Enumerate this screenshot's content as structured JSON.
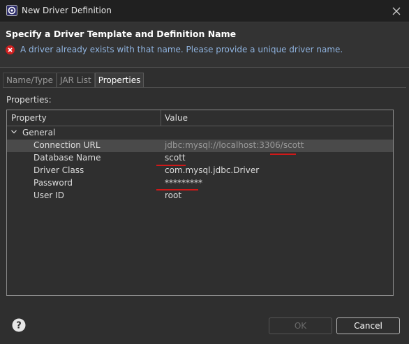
{
  "window": {
    "title": "New Driver Definition"
  },
  "header": {
    "title": "Specify a Driver Template and Definition Name",
    "error_message": "A driver already exists with that name. Please provide a unique driver name."
  },
  "tabs": [
    {
      "label": "Name/Type",
      "active": false
    },
    {
      "label": "JAR List",
      "active": false
    },
    {
      "label": "Properties",
      "active": true
    }
  ],
  "properties_label": "Properties:",
  "table": {
    "columns": [
      "Property",
      "Value"
    ],
    "group": "General",
    "rows": [
      {
        "property": "Connection URL",
        "value": "jdbc:mysql://localhost:3306/scott",
        "selected": true
      },
      {
        "property": "Database Name",
        "value": "scott",
        "selected": false
      },
      {
        "property": "Driver Class",
        "value": "com.mysql.jdbc.Driver",
        "selected": false
      },
      {
        "property": "Password",
        "value": "*********",
        "selected": false
      },
      {
        "property": "User ID",
        "value": "root",
        "selected": false
      }
    ]
  },
  "buttons": {
    "ok": "OK",
    "cancel": "Cancel"
  },
  "colors": {
    "error": "#d02020",
    "error_text": "#8fb3df",
    "annotation": "#d01818"
  }
}
